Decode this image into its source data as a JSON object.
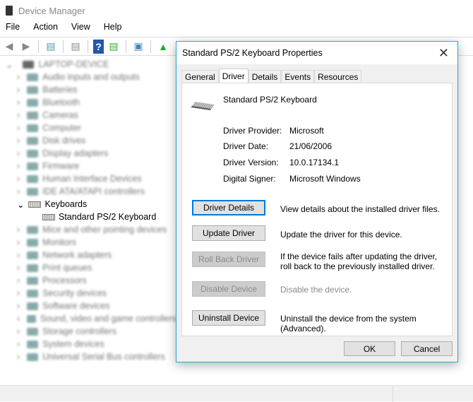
{
  "window": {
    "title": "Device Manager"
  },
  "menu": [
    "File",
    "Action",
    "View",
    "Help"
  ],
  "tree": {
    "root": "LAPTOP-DEVICE",
    "before": [
      "Audio inputs and outputs",
      "Batteries",
      "Bluetooth",
      "Cameras",
      "Computer",
      "Disk drives",
      "Display adapters",
      "Firmware",
      "Human Interface Devices",
      "IDE ATA/ATAPI controllers"
    ],
    "expanded": "Keyboards",
    "child": "Standard PS/2 Keyboard",
    "after": [
      "Mice and other pointing devices",
      "Monitors",
      "Network adapters",
      "Print queues",
      "Processors",
      "Security devices",
      "Software devices",
      "Sound, video and game controllers",
      "Storage controllers",
      "System devices",
      "Universal Serial Bus controllers"
    ]
  },
  "dialog": {
    "title": "Standard PS/2 Keyboard Properties",
    "tabs": [
      "General",
      "Driver",
      "Details",
      "Events",
      "Resources"
    ],
    "device_name": "Standard PS/2 Keyboard",
    "props": [
      {
        "k": "Driver Provider:",
        "v": "Microsoft"
      },
      {
        "k": "Driver Date:",
        "v": "21/06/2006"
      },
      {
        "k": "Driver Version:",
        "v": "10.0.17134.1"
      },
      {
        "k": "Digital Signer:",
        "v": "Microsoft Windows"
      }
    ],
    "actions": [
      {
        "label": "Driver Details",
        "desc": "View details about the installed driver files."
      },
      {
        "label": "Update Driver",
        "desc": "Update the driver for this device."
      },
      {
        "label": "Roll Back Driver",
        "desc": "If the device fails after updating the driver, roll back to the previously installed driver."
      },
      {
        "label": "Disable Device",
        "desc": "Disable the device."
      },
      {
        "label": "Uninstall Device",
        "desc": "Uninstall the device from the system (Advanced)."
      }
    ],
    "ok": "OK",
    "cancel": "Cancel"
  }
}
